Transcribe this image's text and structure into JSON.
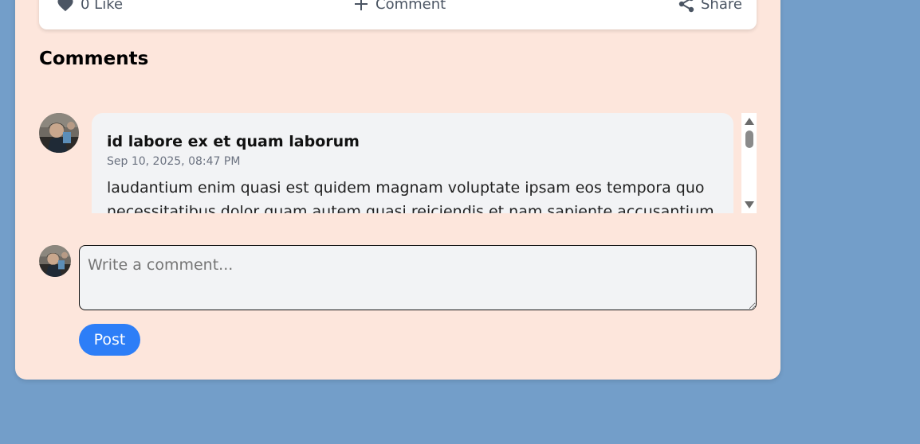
{
  "actions": {
    "like_label": "0 Like",
    "comment_label": "Comment",
    "share_label": "Share"
  },
  "comments_section": {
    "title": "Comments",
    "items": [
      {
        "author": "id labore ex et quam laborum",
        "date": "Sep 10, 2025, 08:47 PM",
        "text": "laudantium enim quasi est quidem magnam voluptate ipsam eos tempora quo necessitatibus dolor quam autem quasi reiciendis et nam sapiente accusantium"
      }
    ]
  },
  "composer": {
    "placeholder": "Write a comment...",
    "value": "",
    "post_label": "Post"
  },
  "icons": {
    "like": "heart-icon",
    "comment": "plus-icon",
    "share": "share-icon"
  },
  "colors": {
    "page_background": "#739ec9",
    "card_background": "#fde6dc",
    "accent": "#2d7ef7"
  }
}
